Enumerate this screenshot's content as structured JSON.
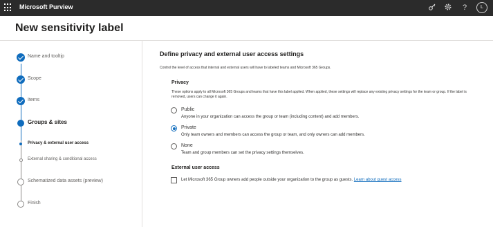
{
  "topbar": {
    "app_title": "Microsoft Purview",
    "icons": [
      "waffle-icon",
      "key-icon",
      "gear-icon",
      "help-icon",
      "avatar"
    ],
    "help_glyph": "?",
    "avatar_initial": "L"
  },
  "header": {
    "title": "New sensitivity label"
  },
  "steps": [
    {
      "label": "Name and tooltip",
      "state": "done"
    },
    {
      "label": "Scope",
      "state": "done"
    },
    {
      "label": "Items",
      "state": "done"
    },
    {
      "label": "Groups & sites",
      "state": "current"
    },
    {
      "label": "Privacy & external user access",
      "state": "sub-current"
    },
    {
      "label": "External sharing & conditional access",
      "state": "sub"
    },
    {
      "label": "Schematized data assets (preview)",
      "state": "todo"
    },
    {
      "label": "Finish",
      "state": "todo"
    }
  ],
  "main": {
    "title": "Define privacy and external user access settings",
    "description": "Control the level of access that internal and external users will have to labeled teams and Microsoft 365 Groups.",
    "privacy": {
      "heading": "Privacy",
      "description": "These options apply to all Microsoft 365 Groups and teams that have this label applied. When applied, these settings will replace any existing privacy settings for the team or group. If the label is removed, users can change it again.",
      "options": [
        {
          "label": "Public",
          "description": "Anyone in your organization can access the group or team (including content) and add members.",
          "selected": false
        },
        {
          "label": "Private",
          "description": "Only team owners and members can access the group or team, and only owners can add members.",
          "selected": true
        },
        {
          "label": "None",
          "description": "Team and group members can set the privacy settings themselves.",
          "selected": false
        }
      ]
    },
    "external": {
      "heading": "External user access",
      "checkbox_label": "Let Microsoft 365 Group owners add people outside your organization to the group as guests.",
      "link_text": "Learn about guest access",
      "checked": false
    }
  },
  "colors": {
    "accent": "#0f6cbd",
    "topbar": "#2b2b2b"
  }
}
